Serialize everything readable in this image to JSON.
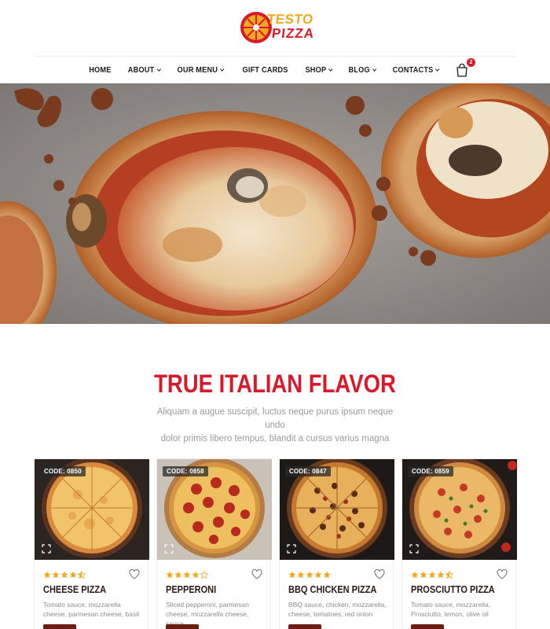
{
  "brand": {
    "line1": "TESTO",
    "line2": "PIZZA",
    "colors": {
      "primary_red": "#d7192a",
      "accent_yellow": "#f2a81d",
      "dark_brown": "#2b1b14"
    }
  },
  "nav": {
    "items": [
      {
        "label": "HOME",
        "dropdown": false
      },
      {
        "label": "ABOUT",
        "dropdown": true
      },
      {
        "label": "OUR MENU",
        "dropdown": true
      },
      {
        "label": "GIFT CARDS",
        "dropdown": false
      },
      {
        "label": "SHOP",
        "dropdown": true
      },
      {
        "label": "BLOG",
        "dropdown": true
      },
      {
        "label": "CONTACTS",
        "dropdown": true
      }
    ],
    "cart": {
      "icon": "shopping-bag-icon",
      "count": "2"
    }
  },
  "hero": {
    "slide_count": 3,
    "active_slide": 2
  },
  "section": {
    "title": "TRUE ITALIAN FLAVOR",
    "subtitle_line1": "Aliquam a augue suscipit, luctus neque purus ipsum neque undo",
    "subtitle_line2": "dolor primis libero tempus, blandit a cursus varius magna"
  },
  "products": [
    {
      "code": "CODE: 0850",
      "name": "CHEESE PIZZA",
      "rating": 4.5,
      "desc_line1": "Tomato sauce, mozzarella",
      "desc_line2": "cheese, parmesan cheese, basil"
    },
    {
      "code": "CODE: 0858",
      "name": "PEPPERONI",
      "rating": 4,
      "desc_line1": "Sliced pepperoni, parmesan",
      "desc_line2": "cheese, mozzarella cheese, sauce"
    },
    {
      "code": "CODE: 0847",
      "name": "BBQ CHICKEN PIZZA",
      "rating": 5,
      "desc_line1": "BBQ sauce, chicken, mozzarella,",
      "desc_line2": "cheese, tomatoes, red onion"
    },
    {
      "code": "CODE: 0859",
      "name": "PROSCIUTTO PIZZA",
      "rating": 4.5,
      "desc_line1": "Tomato sauce, mozzarella,",
      "desc_line2": "Prosciutto, lemon, olive oil"
    }
  ]
}
